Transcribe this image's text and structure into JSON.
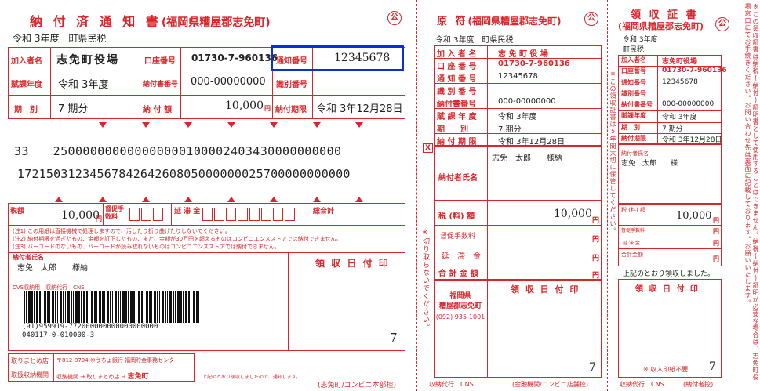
{
  "colors": {
    "accent": "#d8262b",
    "highlight": "#0a2fd6"
  },
  "left": {
    "title": "納 付 済 通 知 書",
    "title_sub": "(福岡県糟屋郡志免町)",
    "seal": "公",
    "era_tax": "令和 3年度　町県民税",
    "subscriber_label": "加入者名",
    "subscriber_value": "志免町役場",
    "account_label": "口座番号",
    "account_value": "01730-7-960136",
    "notice_label": "通知番号",
    "notice_value": "12345678",
    "fiscal_label": "賦課年度",
    "fiscal_value": "令和 3年度",
    "paynum_label": "納付書番号",
    "paynum_value": "000-00000000",
    "hikae_label": "識別番号",
    "term_label": "期　別",
    "term_value": "7 期分",
    "amount_label": "納 付 額",
    "amount_value": "10,000",
    "yen": "円",
    "deadline_label": "納付期限",
    "deadline_value": "令和 3年12月28日",
    "ocr_line1": "33　　250000000000000000100002403430000000000",
    "ocr_line2": "1721503123456784264260805000000025700000000000",
    "tax_label": "税額",
    "tax_value": "10,000",
    "fee_label": "督促手数料",
    "late_label": "延 滞 金",
    "total_label": "総合計",
    "notes": [
      "(注1) この用紙は直接機械で処理しますので、汚したり折り曲げたりしないでください。",
      "(注2) 納付期限を過ぎたもの、金額を訂正したもの、また、金額が30万円を超えるものはコンビニエンスストアでは納付できません。",
      "(注3) バーコードのないもの、バーコードが読み取れないものはコンビニエンスストアでは納付できません。"
    ],
    "payer_label": "納付者氏名",
    "payer_value": "志免　太郎　　様納",
    "receipt_stamp": "領 収 日 付 印",
    "cvs_caption": "CVS収納用　収納代行　CNS",
    "barcode_num": "(91)959919-772000000000000000000",
    "barcode_num2": "040117-0-010000-3",
    "stamp_digit": "7",
    "bottom_r1_label": "取りまとめ店",
    "bottom_r1_value": "〒812-8794 ゆうちょ銀行 福岡貯金事務センター",
    "bottom_r2_label": "取扱収納機関",
    "bottom_r2_value": "収納機関 → 取りまとめ店 →",
    "bottom_r2_strong": "志免町",
    "bottom_note": "上記のとおり領収しましたので、通知します。",
    "bottom_caption": "(志免町/コンビニ本部控)"
  },
  "mid": {
    "title": "原 符",
    "title_sub": "(福岡県糟屋郡志免町)",
    "seal": "公",
    "era_tax": "令和 3年度　町県民税",
    "rows": [
      {
        "label": "加 入 者 名",
        "value": "志 免 町 役 場"
      },
      {
        "label": "口 座 番 号",
        "value": "01730-7-960136"
      },
      {
        "label": "通 知 番 号",
        "value": "12345678"
      },
      {
        "label": "識 別 番 号",
        "value": ""
      },
      {
        "label": "納付書番号",
        "value": "000-00000000"
      },
      {
        "label": "賦 課 年 度",
        "value": "令和 3年度"
      },
      {
        "label": "期　　別",
        "value": "7 期分"
      },
      {
        "label": "納 付 期 限",
        "value": "令和 3年12月28日"
      }
    ],
    "payer_label": "納付者氏名",
    "payer_value": "志免　太郎　　様納",
    "x_mark": "X",
    "tax_label": "税 (料) 額",
    "tax_value": "10,000",
    "yen": "円",
    "fee_label": "督促手数料",
    "late_label": "延　滞　金",
    "total_label": "合 計 金 額",
    "stamp_label": "領 収 日 付 印",
    "stamp_lines": [
      "福岡県",
      "糟屋郡志免町",
      "(092) 935-1001"
    ],
    "stamp_digit": "7",
    "cut_note": "※切り取らないでください。",
    "bottom_caption_left": "収納代行　CNS",
    "bottom_caption_right": "(金融機関/コンビニ店舗控)"
  },
  "right": {
    "title": "領 収 証 書",
    "title_sub": "(福岡県糟屋郡志免町)",
    "seal": "公",
    "era": "令和 3年度",
    "tax": "町民税",
    "rows": [
      {
        "label": "加入者名",
        "value": "志免町役場"
      },
      {
        "label": "口座番号",
        "value": "01730-7-960136"
      },
      {
        "label": "通知番号",
        "value": "12345678"
      },
      {
        "label": "識別番号",
        "value": ""
      },
      {
        "label": "納付書番号",
        "value": "000-00000000"
      },
      {
        "label": "賦課年度",
        "value": "令和 3年度"
      },
      {
        "label": "期　別",
        "value": "7 期分"
      },
      {
        "label": "納付期限",
        "value": "令和 3年12月28日"
      }
    ],
    "payer_label": "納付者氏名",
    "payer_value": "志免　太郎　　様",
    "tax_label": "税 (料) 額",
    "tax_value": "10,000",
    "yen": "円",
    "fee_label": "督促手数料",
    "late_label": "延 滞 金",
    "total_label": "合計金額",
    "received_note": "上記のとおり領収しました。",
    "stamp_label": "領 収 日 付 印",
    "stamp_digit": "7",
    "seal_note": "※ 収入印紙不要",
    "cut_note": "※この領収証書は5年間大切に保管してください。",
    "bottom_caption_left": "収納代行　CNS",
    "bottom_caption_right": "(納付者控)"
  },
  "edge_note": "※この領収証書は納税(納付)証明書として使用することはできません。納税(納付)証明が必要な場合は、志免町役場窓口にてお手続きください。お問い合わせ先は裏面に記載しております。お願いいたします。"
}
